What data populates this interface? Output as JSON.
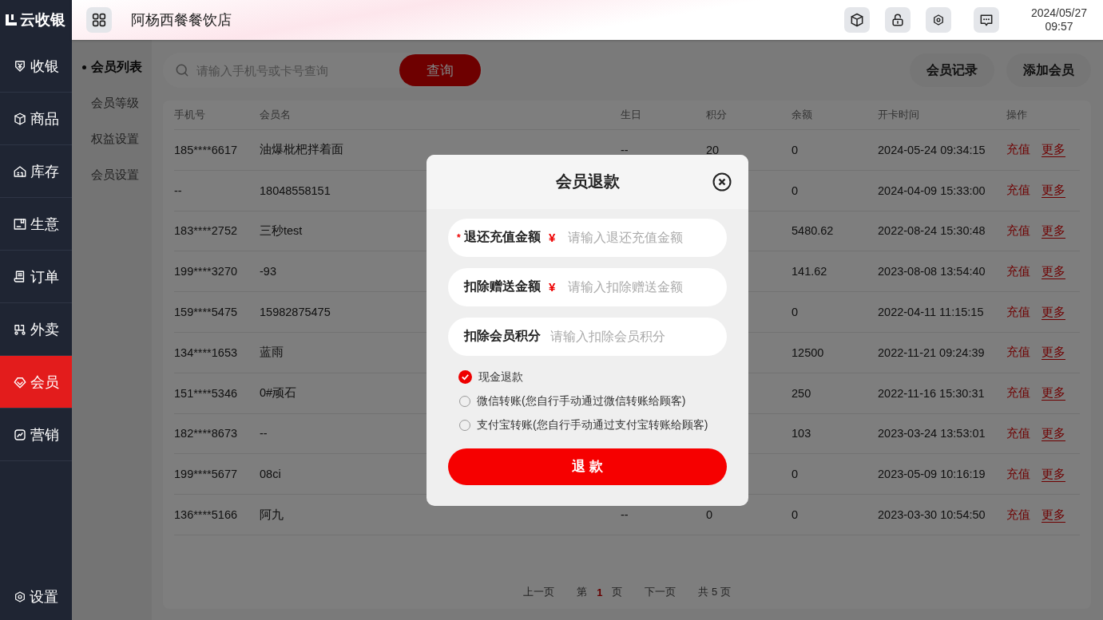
{
  "brand": {
    "name": "云收银"
  },
  "header": {
    "store_name": "阿杨西餐餐饮店",
    "date": "2024/05/27",
    "time": "09:57"
  },
  "sidebar": {
    "items": [
      {
        "label": "收银",
        "selected": false
      },
      {
        "label": "商品",
        "selected": false
      },
      {
        "label": "库存",
        "selected": false
      },
      {
        "label": "生意",
        "selected": false
      },
      {
        "label": "订单",
        "selected": false
      },
      {
        "label": "外卖",
        "selected": false
      },
      {
        "label": "会员",
        "selected": true
      },
      {
        "label": "营销",
        "selected": false
      }
    ],
    "footer_item": {
      "label": "设置"
    }
  },
  "submenu": {
    "items": [
      {
        "label": "会员列表",
        "selected": true
      },
      {
        "label": "会员等级",
        "selected": false
      },
      {
        "label": "权益设置",
        "selected": false
      },
      {
        "label": "会员设置",
        "selected": false
      }
    ]
  },
  "search": {
    "placeholder": "请输入手机号或卡号查询",
    "button": "查询"
  },
  "toolbar_buttons": [
    "会员记录",
    "添加会员"
  ],
  "table": {
    "columns": [
      "手机号",
      "会员名",
      "生日",
      "积分",
      "余额",
      "开卡时间",
      "操作"
    ],
    "rows": [
      {
        "phone": "185****6617",
        "name": "油爆枇杷拌着面",
        "birthday": "--",
        "points": "20",
        "balance": "0",
        "opened": "2024-05-24 09:34:15",
        "actions": [
          "充值",
          "更多"
        ]
      },
      {
        "phone": "--",
        "name": "18048558151",
        "balance": "0",
        "opened": "2024-04-09 15:33:00",
        "actions": [
          "充值",
          "更多"
        ]
      },
      {
        "phone": "183****2752",
        "name": "三秒test",
        "balance": "5480.62",
        "opened": "2022-08-24 15:30:48",
        "actions": [
          "充值",
          "更多"
        ]
      },
      {
        "phone": "199****3270",
        "name": "-93",
        "balance": "141.62",
        "opened": "2023-08-08 13:54:40",
        "actions": [
          "充值",
          "更多"
        ]
      },
      {
        "phone": "159****5475",
        "name": "15982875475",
        "balance": "0",
        "opened": "2022-04-11 11:15:15",
        "actions": [
          "充值",
          "更多"
        ]
      },
      {
        "phone": "134****1653",
        "name": "蓝雨",
        "balance": "12500",
        "opened": "2022-11-21 09:24:39",
        "actions": [
          "充值",
          "更多"
        ]
      },
      {
        "phone": "151****5346",
        "name": "0#顽石",
        "balance": "250",
        "opened": "2022-11-16 15:30:31",
        "actions": [
          "充值",
          "更多"
        ]
      },
      {
        "phone": "182****8673",
        "name": "--",
        "balance": "103",
        "opened": "2023-03-24 13:53:01",
        "actions": [
          "充值",
          "更多"
        ]
      },
      {
        "phone": "199****5677",
        "name": "08ci",
        "balance": "0",
        "opened": "2023-05-09 10:16:19",
        "actions": [
          "充值",
          "更多"
        ]
      },
      {
        "phone": "136****5166",
        "name": "阿九",
        "birthday": "--",
        "points": "0",
        "balance": "0",
        "opened": "2023-03-30 10:54:50",
        "actions": [
          "充值",
          "更多"
        ]
      }
    ]
  },
  "pagination": {
    "prev": "上一页",
    "page_prefix": "第",
    "current": "1",
    "page_suffix": "页",
    "next": "下一页",
    "total": "共 5 页"
  },
  "dialog": {
    "title": "会员退款",
    "fields": [
      {
        "label": "退还充值金额",
        "required": true,
        "currency": "¥",
        "placeholder": "请输入退还充值金额"
      },
      {
        "label": "扣除赠送金额",
        "required": false,
        "currency": "¥",
        "placeholder": "请输入扣除赠送金额"
      },
      {
        "label": "扣除会员积分",
        "required": false,
        "placeholder": "请输入扣除会员积分"
      }
    ],
    "required_mark": "*",
    "payment_options": [
      {
        "label": "现金退款",
        "selected": true
      },
      {
        "label": "微信转账(您自行手动通过微信转账给顾客)",
        "selected": false
      },
      {
        "label": "支付宝转账(您自行手动通过支付宝转账给顾客)",
        "selected": false
      }
    ],
    "submit": "退 款"
  }
}
